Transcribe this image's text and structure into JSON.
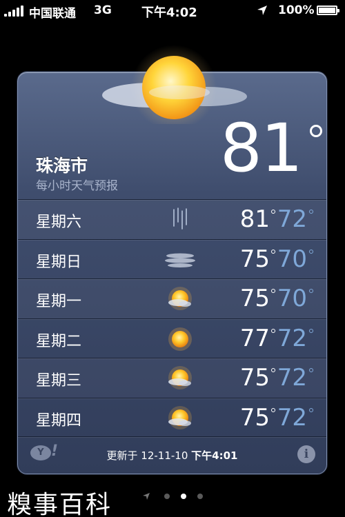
{
  "status_bar": {
    "carrier": "中国联通",
    "network": "3G",
    "time": "下午4:02",
    "battery_percent": "100%",
    "battery_level": 1.0
  },
  "weather": {
    "city": "珠海市",
    "subtitle": "每小时天气预报",
    "current_temp": "81",
    "forecast": [
      {
        "day": "星期六",
        "icon": "rain-icon",
        "high": "81",
        "low": "72"
      },
      {
        "day": "星期日",
        "icon": "fog-icon",
        "high": "75",
        "low": "70"
      },
      {
        "day": "星期一",
        "icon": "partly-cloudy-icon",
        "high": "75",
        "low": "70"
      },
      {
        "day": "星期二",
        "icon": "sun-icon",
        "high": "77",
        "low": "72"
      },
      {
        "day": "星期三",
        "icon": "partly-cloudy-icon",
        "high": "75",
        "low": "72"
      },
      {
        "day": "星期四",
        "icon": "partly-cloudy-icon",
        "high": "75",
        "low": "72"
      }
    ],
    "updated_prefix": "更新于",
    "updated_date": "12-11-10",
    "updated_time": "下午4:01",
    "yahoo_label": "Y!",
    "info_label": "i"
  },
  "watermark": "糗事百科",
  "page_dots": {
    "count": 3,
    "active_index": 1
  },
  "colors": {
    "low_temp": "#7fa8d8",
    "card_top": "#5a6a8c",
    "card_bottom": "#313d5a"
  }
}
